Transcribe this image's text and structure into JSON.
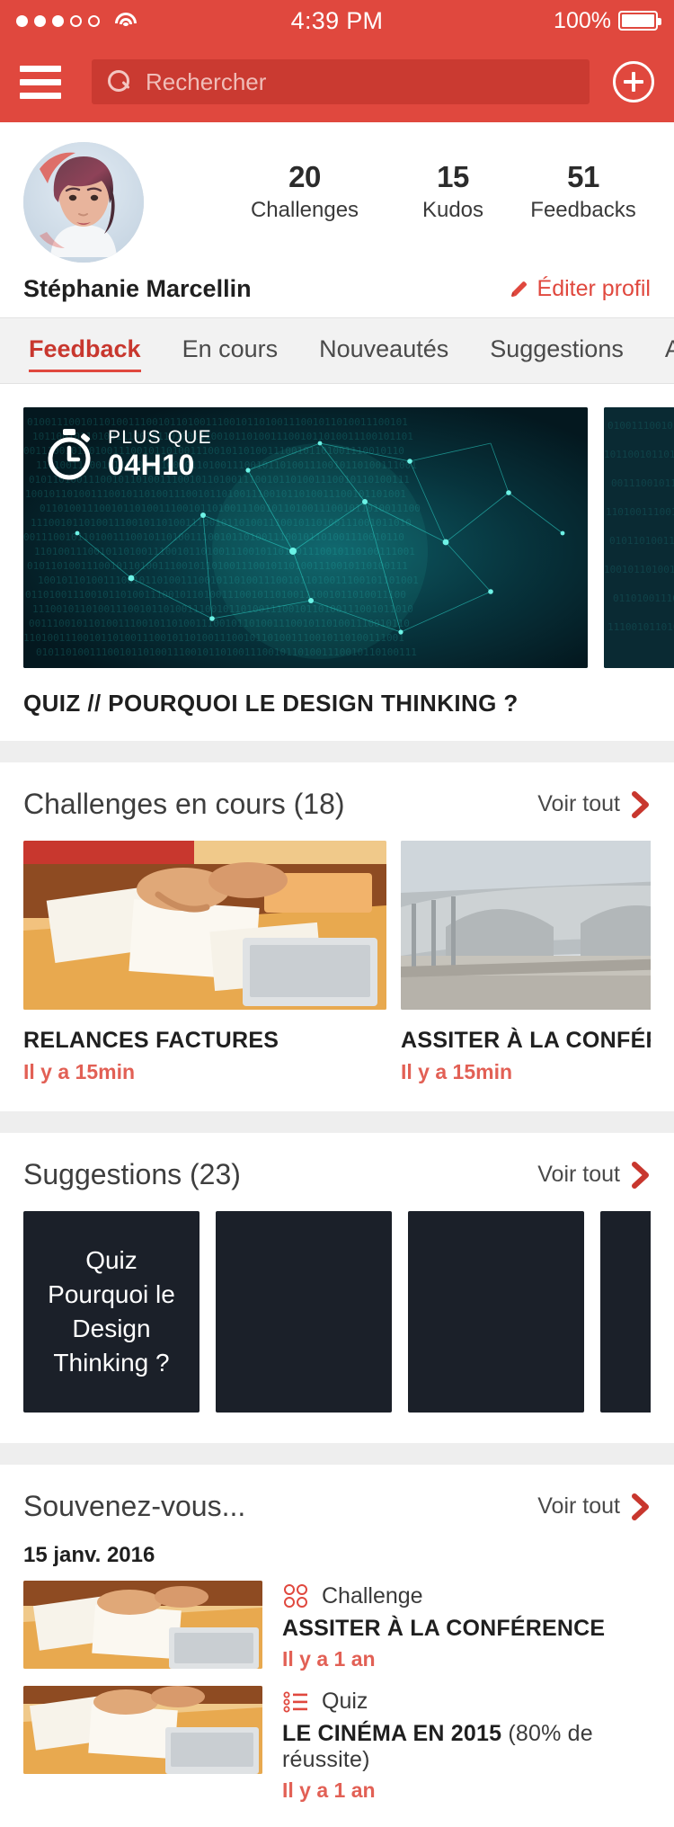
{
  "colors": {
    "brand_red": "#e0483e",
    "brand_red_dark": "#ca3a31",
    "accent_red": "#c8372e",
    "soft_red": "#e26055",
    "card_dark": "#1b2029",
    "page_gray": "#eeeeee"
  },
  "statusbar": {
    "signal_icon": "signal-dots",
    "wifi_icon": "wifi-icon",
    "time": "4:39 PM",
    "battery_pct": "100%",
    "battery_icon": "battery-full-icon"
  },
  "navbar": {
    "menu_icon": "hamburger-icon",
    "search_icon": "search-icon",
    "search_value": "",
    "search_placeholder": "Rechercher",
    "add_icon": "plus-circle-icon"
  },
  "profile": {
    "avatar_icon": "avatar",
    "name": "Stéphanie Marcellin",
    "edit_label": "Éditer profil",
    "edit_icon": "pencil-icon",
    "stats": [
      {
        "value": "20",
        "label": "Challenges"
      },
      {
        "value": "15",
        "label": "Kudos"
      },
      {
        "value": "51",
        "label": "Feedbacks"
      }
    ]
  },
  "tabs": [
    {
      "label": "Feedback",
      "active": true
    },
    {
      "label": "En cours",
      "active": false
    },
    {
      "label": "Nouveautés",
      "active": false
    },
    {
      "label": "Suggestions",
      "active": false
    },
    {
      "label": "A",
      "active": false
    }
  ],
  "hero": {
    "timer_icon": "stopwatch-icon",
    "timer_caption": "PLUS QUE",
    "timer_value": "04H10",
    "title": "QUIZ // POURQUOI LE DESIGN THINKING ?"
  },
  "challenges_section": {
    "title": "Challenges en cours (18)",
    "see_all": "Voir tout",
    "see_all_icon": "chevron-right-icon",
    "cards": [
      {
        "title": "RELANCES FACTURES",
        "ago": "Il y a 15min",
        "image": "desk-papers-photo"
      },
      {
        "title": "ASSITER À LA CONFÉRENCE",
        "ago": "Il y a 15min",
        "image": "bridge-photo"
      }
    ]
  },
  "suggestions_section": {
    "title": "Suggestions (23)",
    "see_all": "Voir tout",
    "see_all_icon": "chevron-right-icon",
    "cards": [
      {
        "text": "Quiz Pourquoi le Design Thinking ?"
      },
      {
        "text": ""
      },
      {
        "text": ""
      },
      {
        "text": ""
      }
    ]
  },
  "memories_section": {
    "title": "Souvenez-vous...",
    "see_all": "Voir tout",
    "see_all_icon": "chevron-right-icon",
    "date": "15 janv. 2016",
    "items": [
      {
        "kind_icon": "challenge-dots-icon",
        "kind": "Challenge",
        "title": "ASSITER À LA CONFÉRENCE",
        "extra": "",
        "ago": "Il y a 1 an",
        "image": "desk-papers-photo"
      },
      {
        "kind_icon": "quiz-list-icon",
        "kind": "Quiz",
        "title": "LE CINÉMA EN 2015",
        "extra": "(80% de réussite)",
        "ago": "Il y a 1 an",
        "image": "desk-papers-photo"
      }
    ]
  }
}
